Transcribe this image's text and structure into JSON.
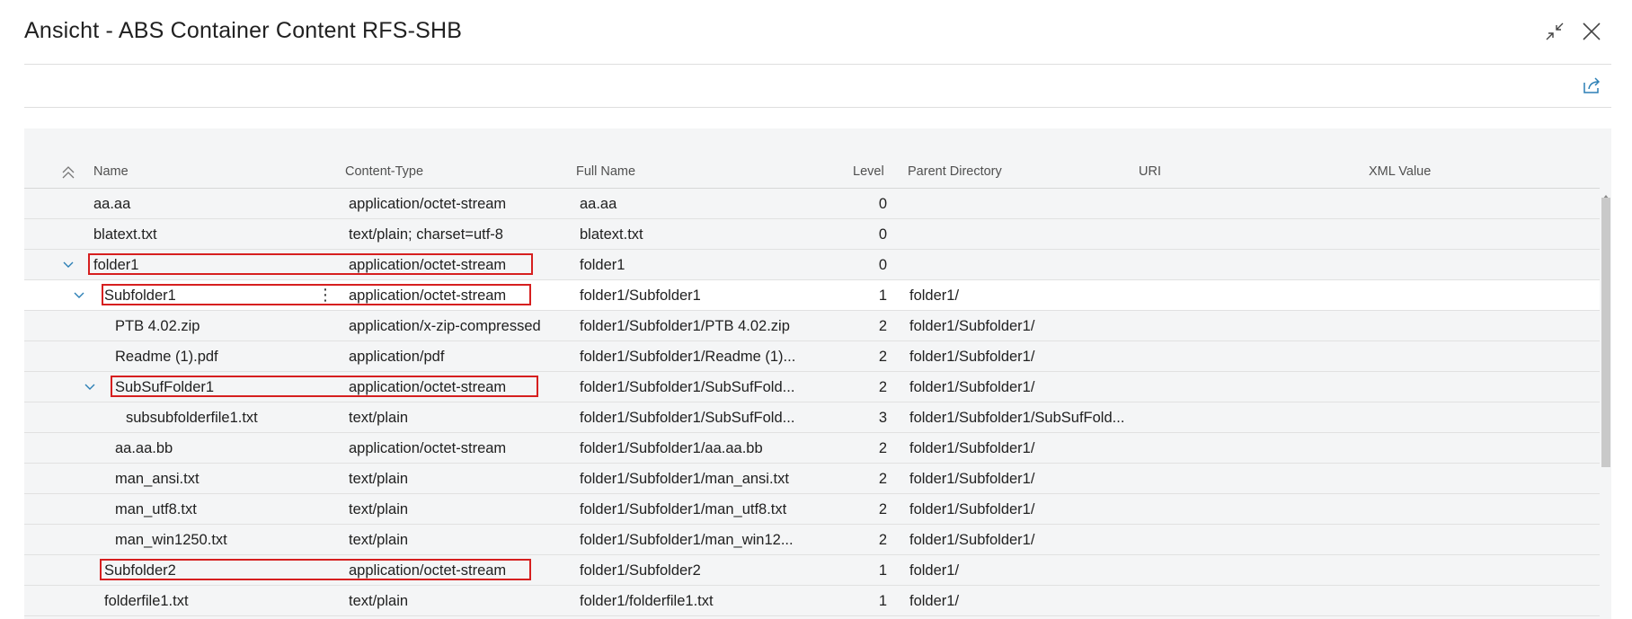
{
  "window": {
    "title": "Ansicht - ABS Container Content RFS-SHB"
  },
  "icons": {
    "collapse": "collapse-arrows-icon",
    "close": "close-x-icon",
    "share": "share-icon",
    "sort": "double-chevron-up-icon",
    "expand": "chevron-down-icon",
    "more": "vertical-ellipsis-icon"
  },
  "colors": {
    "accent": "#2b7fb5",
    "highlight": "#d61f1f",
    "grid_bg": "#f4f5f6"
  },
  "table": {
    "columns": [
      "Name",
      "Content-Type",
      "Full Name",
      "Level",
      "Parent Directory",
      "URI",
      "XML Value"
    ],
    "rows": [
      {
        "name": "aa.aa",
        "content_type": "application/octet-stream",
        "full_name": "aa.aa",
        "level": "0",
        "parent": ""
      },
      {
        "name": "blatext.txt",
        "content_type": "text/plain; charset=utf-8",
        "full_name": "blatext.txt",
        "level": "0",
        "parent": ""
      },
      {
        "name": "folder1",
        "content_type": "application/octet-stream",
        "full_name": "folder1",
        "level": "0",
        "parent": ""
      },
      {
        "name": "Subfolder1",
        "content_type": "application/octet-stream",
        "full_name": "folder1/Subfolder1",
        "level": "1",
        "parent": "folder1/"
      },
      {
        "name": "PTB 4.02.zip",
        "content_type": "application/x-zip-compressed",
        "full_name": "folder1/Subfolder1/PTB 4.02.zip",
        "level": "2",
        "parent": "folder1/Subfolder1/"
      },
      {
        "name": "Readme (1).pdf",
        "content_type": "application/pdf",
        "full_name": "folder1/Subfolder1/Readme (1)...",
        "level": "2",
        "parent": "folder1/Subfolder1/"
      },
      {
        "name": "SubSufFolder1",
        "content_type": "application/octet-stream",
        "full_name": "folder1/Subfolder1/SubSufFold...",
        "level": "2",
        "parent": "folder1/Subfolder1/"
      },
      {
        "name": "subsubfolderfile1.txt",
        "content_type": "text/plain",
        "full_name": "folder1/Subfolder1/SubSufFold...",
        "level": "3",
        "parent": "folder1/Subfolder1/SubSufFold..."
      },
      {
        "name": "aa.aa.bb",
        "content_type": "application/octet-stream",
        "full_name": "folder1/Subfolder1/aa.aa.bb",
        "level": "2",
        "parent": "folder1/Subfolder1/"
      },
      {
        "name": "man_ansi.txt",
        "content_type": "text/plain",
        "full_name": "folder1/Subfolder1/man_ansi.txt",
        "level": "2",
        "parent": "folder1/Subfolder1/"
      },
      {
        "name": "man_utf8.txt",
        "content_type": "text/plain",
        "full_name": "folder1/Subfolder1/man_utf8.txt",
        "level": "2",
        "parent": "folder1/Subfolder1/"
      },
      {
        "name": "man_win1250.txt",
        "content_type": "text/plain",
        "full_name": "folder1/Subfolder1/man_win12...",
        "level": "2",
        "parent": "folder1/Subfolder1/"
      },
      {
        "name": "Subfolder2",
        "content_type": "application/octet-stream",
        "full_name": "folder1/Subfolder2",
        "level": "1",
        "parent": "folder1/"
      },
      {
        "name": "folderfile1.txt",
        "content_type": "text/plain",
        "full_name": "folder1/folderfile1.txt",
        "level": "1",
        "parent": "folder1/"
      }
    ]
  }
}
